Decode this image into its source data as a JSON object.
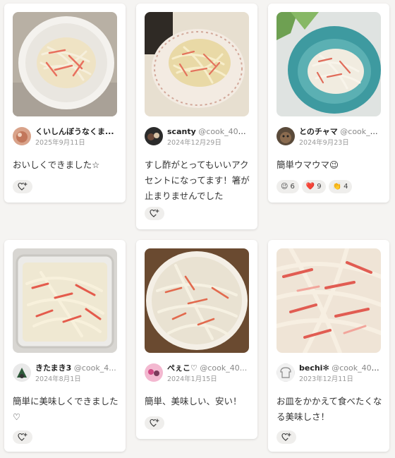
{
  "cards": [
    {
      "name": "くいしんぼうなくま...",
      "handle": "",
      "date": "2025年9月11日",
      "comment": "おいしくできました☆",
      "reactions": []
    },
    {
      "name": "scanty",
      "handle": "@cook_4006...",
      "date": "2024年12月29日",
      "comment": "すし酢がとってもいいアクセントになってます！箸が止まりませんでした",
      "reactions": []
    },
    {
      "name": "とのチャマ",
      "handle": "@cook_4...",
      "date": "2024年9月23日",
      "comment": "簡単ウマウマ😉",
      "reactions": [
        {
          "emoji": "😉",
          "count": "6"
        },
        {
          "emoji": "❤️",
          "count": "9"
        },
        {
          "emoji": "👏",
          "count": "4"
        }
      ]
    },
    {
      "name": "きたまき3",
      "handle": "@cook_4...",
      "date": "2024年8月1日",
      "comment": "簡単に美味しくできました♡",
      "reactions": []
    },
    {
      "name": "ぺぇこ♡",
      "handle": "@cook_40...",
      "date": "2024年1月15日",
      "comment": "簡単、美味しい、安い！",
      "reactions": []
    },
    {
      "name": "bechi✻",
      "handle": "@cook_402...",
      "date": "2023年12月11日",
      "comment": "お皿をかかえて食べたくなる美味しさ！",
      "reactions": []
    }
  ],
  "icons": {
    "add_reaction": "heart-plus-icon"
  },
  "colors": {
    "crab_red": "#e0564a",
    "daikon": "#f3ede0"
  }
}
